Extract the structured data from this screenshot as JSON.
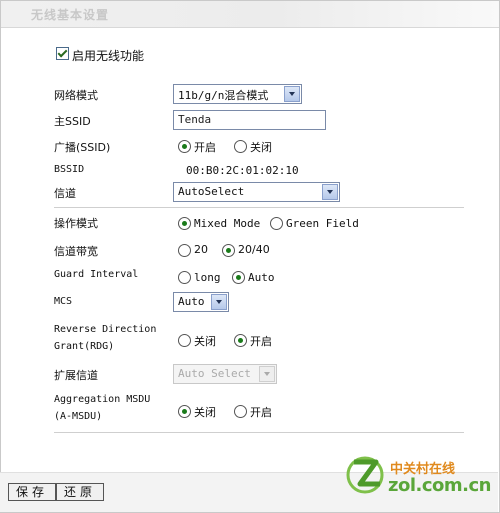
{
  "page": {
    "title": "无线基本设置"
  },
  "enable_wireless": {
    "label": "启用无线功能",
    "checked": true
  },
  "fields": {
    "network_mode": {
      "label": "网络模式",
      "value": "11b/g/n混合模式"
    },
    "ssid": {
      "label": "主SSID",
      "value": "Tenda"
    },
    "broadcast": {
      "label": "广播(SSID)",
      "options": [
        "开启",
        "关闭"
      ],
      "selected": "开启"
    },
    "bssid": {
      "label": "BSSID",
      "value": "00:B0:2C:01:02:10"
    },
    "channel": {
      "label": "信道",
      "value": "AutoSelect"
    },
    "op_mode": {
      "label": "操作模式",
      "options": [
        "Mixed Mode",
        "Green Field"
      ],
      "selected": "Mixed Mode"
    },
    "bandwidth": {
      "label": "信道带宽",
      "options": [
        "20",
        "20/40"
      ],
      "selected": "20/40"
    },
    "guard_interval": {
      "label": "Guard Interval",
      "options": [
        "long",
        "Auto"
      ],
      "selected": "Auto"
    },
    "mcs": {
      "label": "MCS",
      "value": "Auto"
    },
    "rdg": {
      "label_line1": "Reverse Direction",
      "label_line2": "Grant(RDG)",
      "options": [
        "关闭",
        "开启"
      ],
      "selected": "开启"
    },
    "ext_channel": {
      "label": "扩展信道",
      "value": "Auto Select",
      "disabled": true
    },
    "amsdu": {
      "label_line1": "Aggregation MSDU",
      "label_line2": "(A-MSDU)",
      "options": [
        "关闭",
        "开启"
      ],
      "selected": "关闭"
    }
  },
  "buttons": {
    "save": "保存",
    "restore": "还原"
  },
  "watermark": {
    "cn": "中关村在线",
    "en": "zol.com.cn"
  },
  "colors": {
    "accent_green": "#1a7a1a",
    "select_border": "#7a8aa8",
    "logo_orange": "#e08a1e",
    "logo_green": "#5aa63a"
  }
}
